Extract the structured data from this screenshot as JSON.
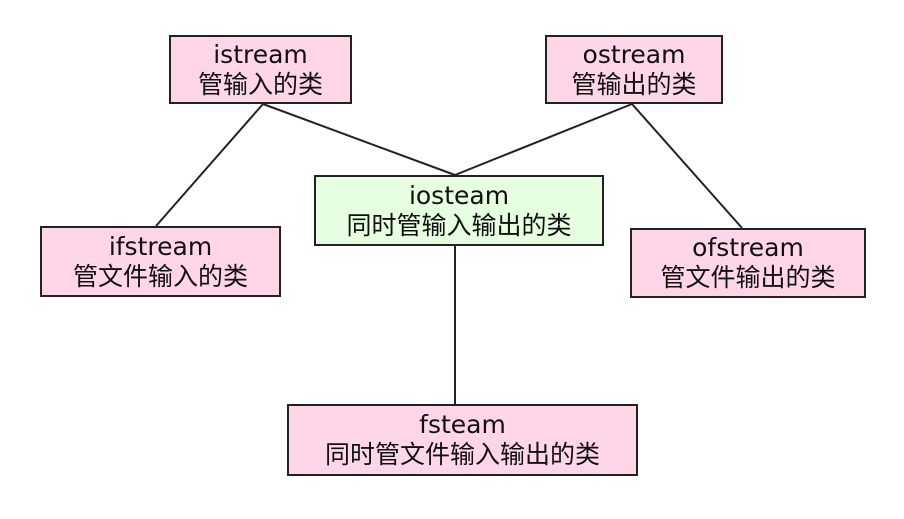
{
  "colors": {
    "class_box": "#ffd6e8",
    "combined_box": "#e6ffe0",
    "line": "#222222"
  },
  "nodes": {
    "istream": {
      "name": "istream",
      "desc": "管输入的类"
    },
    "ostream": {
      "name": "ostream",
      "desc": "管输出的类"
    },
    "iosteam": {
      "name": "iosteam",
      "desc": "同时管输入输出的类"
    },
    "ifstream": {
      "name": "ifstream",
      "desc": "管文件输入的类"
    },
    "ofstream": {
      "name": "ofstream",
      "desc": "管文件输出的类"
    },
    "fsteam": {
      "name": "fsteam",
      "desc": "同时管文件输入输出的类"
    }
  },
  "edges": [
    {
      "from": "istream",
      "to": "ifstream"
    },
    {
      "from": "istream",
      "to": "iosteam"
    },
    {
      "from": "ostream",
      "to": "iosteam"
    },
    {
      "from": "ostream",
      "to": "ofstream"
    },
    {
      "from": "iosteam",
      "to": "fsteam"
    }
  ]
}
